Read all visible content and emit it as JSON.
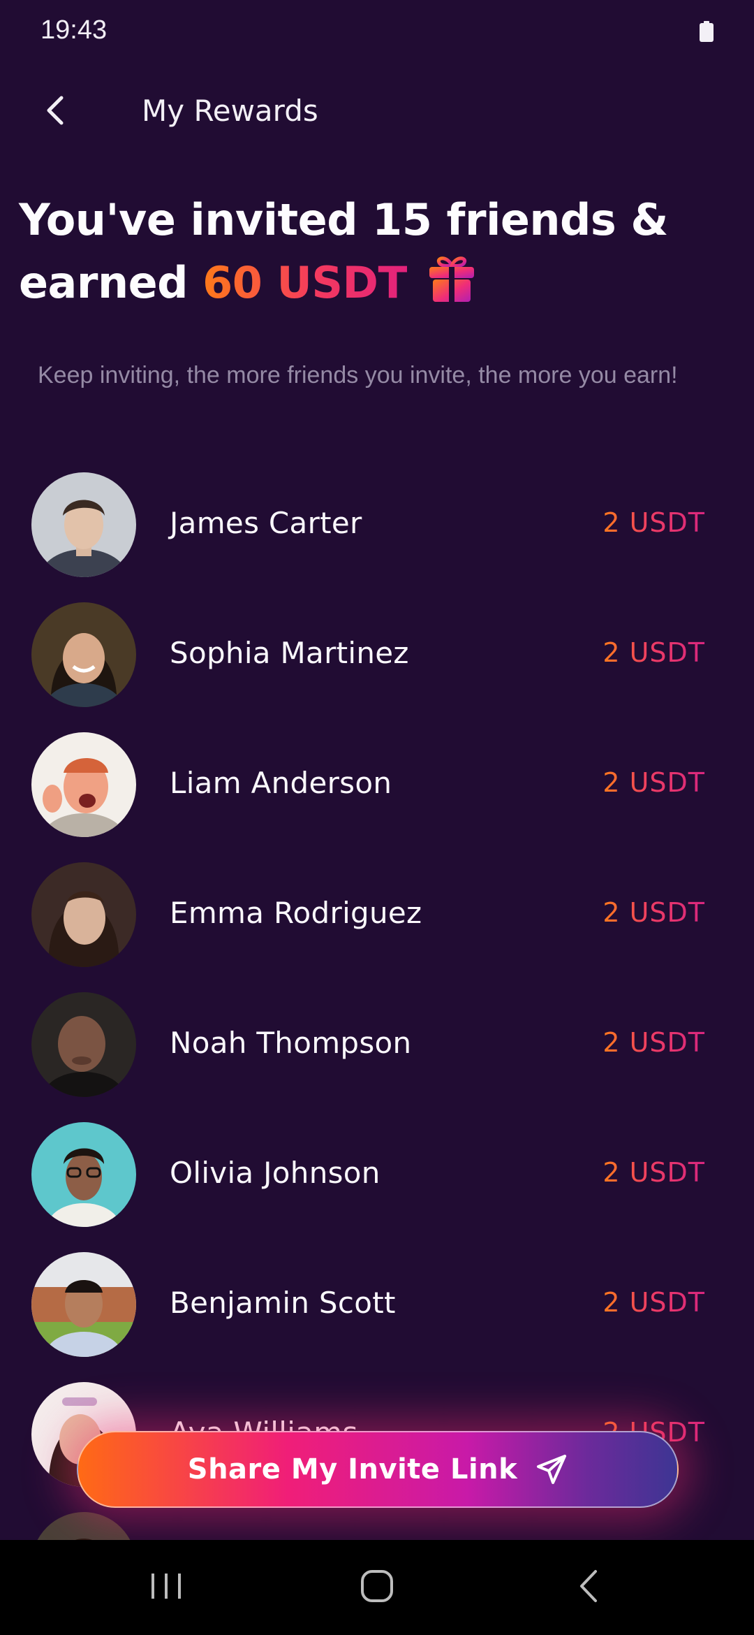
{
  "status_bar": {
    "time": "19:43",
    "battery_icon": "battery-icon"
  },
  "app_bar": {
    "title": "My Rewards",
    "back_icon": "chevron-left-icon"
  },
  "headline": {
    "prefix": "You've invited 15 friends & earned ",
    "amount": "60 USDT",
    "gift_icon": "gift-icon"
  },
  "subtext": "Keep inviting, the more friends you invite, the more you earn!",
  "friends": [
    {
      "name": "James Carter",
      "reward": "2 USDT"
    },
    {
      "name": "Sophia Martinez",
      "reward": "2 USDT"
    },
    {
      "name": "Liam Anderson",
      "reward": "2 USDT"
    },
    {
      "name": "Emma Rodriguez",
      "reward": "2 USDT"
    },
    {
      "name": "Noah Thompson",
      "reward": "2 USDT"
    },
    {
      "name": "Olivia Johnson",
      "reward": "2 USDT"
    },
    {
      "name": "Benjamin Scott",
      "reward": "2 USDT"
    },
    {
      "name": "Ava Williams",
      "reward": "2 USDT"
    }
  ],
  "share_button": {
    "label": "Share My Invite Link",
    "icon": "send-icon"
  },
  "nav_bar": {
    "recents_icon": "recents-icon",
    "home_icon": "home-icon",
    "back_icon": "back-icon"
  },
  "colors": {
    "background": "#210c33",
    "accent_orange": "#ff7a1a",
    "accent_pink": "#e2227c",
    "subtext": "#958aa5"
  }
}
